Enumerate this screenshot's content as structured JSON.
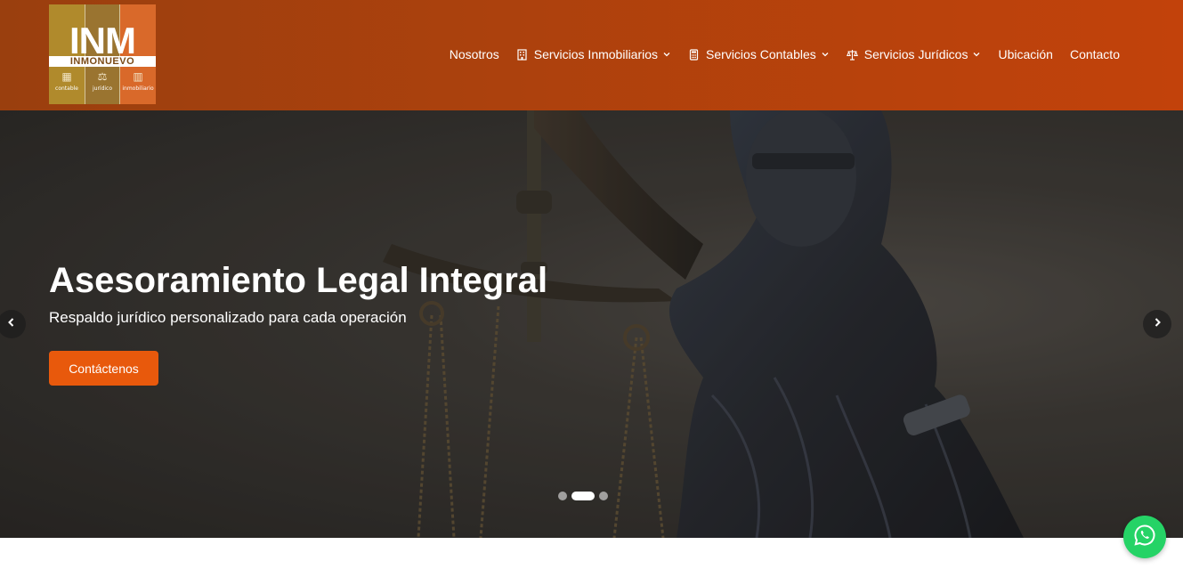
{
  "logo": {
    "big_text": "INM",
    "band_text": "INMONUEVO",
    "sub_labels": [
      "contable",
      "jurídico",
      "inmobiliario"
    ],
    "icons": [
      "building-icon",
      "scales-icon",
      "city-icon"
    ]
  },
  "nav": {
    "items": [
      {
        "label": "Nosotros",
        "icon": null,
        "dropdown": false
      },
      {
        "label": "Servicios Inmobiliarios",
        "icon": "building-icon",
        "dropdown": true
      },
      {
        "label": "Servicios Contables",
        "icon": "calculator-icon",
        "dropdown": true
      },
      {
        "label": "Servicios Jurídicos",
        "icon": "scales-icon",
        "dropdown": true
      },
      {
        "label": "Ubicación",
        "icon": null,
        "dropdown": false
      },
      {
        "label": "Contacto",
        "icon": null,
        "dropdown": false
      }
    ]
  },
  "hero": {
    "title": "Asesoramiento Legal Integral",
    "subtitle": "Respaldo jurídico personalizado para cada operación",
    "cta_label": "Contáctenos",
    "slide_count": 3,
    "active_slide": 2
  },
  "colors": {
    "header_start": "#9a3f0e",
    "header_end": "#c2420b",
    "cta": "#e8590c",
    "whatsapp": "#25d366"
  },
  "floating": {
    "whatsapp_icon": "whatsapp-icon"
  }
}
